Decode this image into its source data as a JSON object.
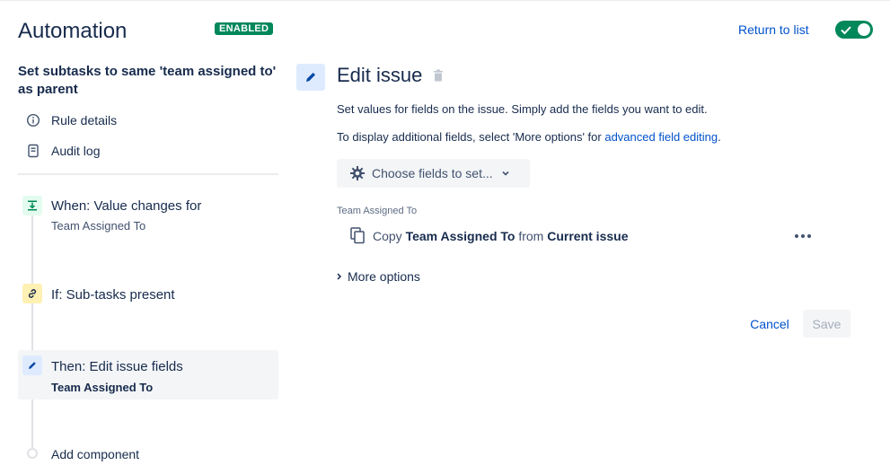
{
  "app": {
    "title": "Automation",
    "status_badge": "ENABLED"
  },
  "rule": {
    "name": "Set subtasks to same 'team assigned to' as parent"
  },
  "nav": {
    "items": [
      {
        "label": "Rule details",
        "icon": "info-icon"
      },
      {
        "label": "Audit log",
        "icon": "document-icon"
      }
    ]
  },
  "steps": [
    {
      "title": "When: Value changes for",
      "subtitle": "Team Assigned To",
      "icon": "trigger-icon",
      "color": "#e3fcef",
      "icon_color": "#00875a"
    },
    {
      "title": "If: Sub-tasks present",
      "subtitle": "",
      "icon": "link-icon",
      "color": "#fff0b3",
      "icon_color": "#172b4d"
    },
    {
      "title": "Then: Edit issue fields",
      "subtitle": "Team Assigned To",
      "icon": "pencil-icon",
      "color": "#deebff",
      "icon_color": "#0747a6",
      "selected": true
    }
  ],
  "add_component_label": "Add component",
  "header": {
    "return_link": "Return to list",
    "toggle_on": true
  },
  "action": {
    "title": "Edit issue",
    "desc1": "Set values for fields on the issue. Simply add the fields you want to edit.",
    "desc2_prefix": "To display additional fields, select 'More options' for ",
    "desc2_link": "advanced field editing",
    "desc2_suffix": ".",
    "choose_button": "Choose fields to set...",
    "field_label": "Team Assigned To",
    "field_value": {
      "verb": "Copy",
      "field": "Team Assigned To",
      "from": "from",
      "source": "Current issue"
    },
    "more_options": "More options",
    "cancel": "Cancel",
    "save": "Save"
  },
  "colors": {
    "accent": "#0052cc",
    "success": "#00875a",
    "text": "#172b4d"
  }
}
